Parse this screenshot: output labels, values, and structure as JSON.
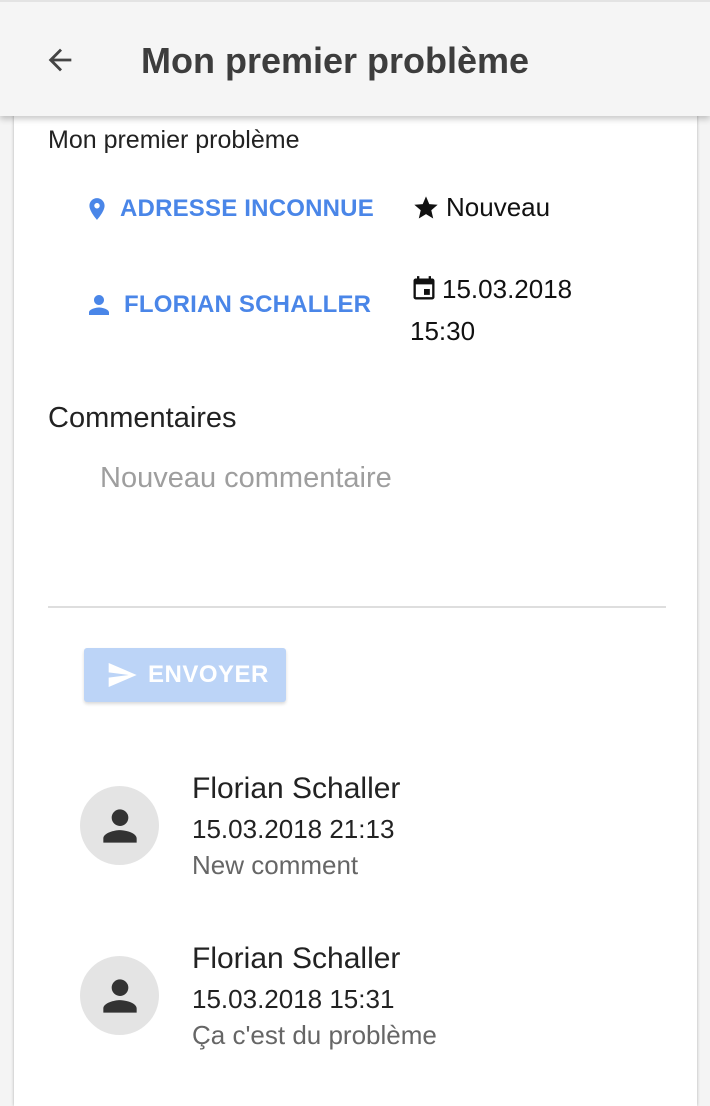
{
  "header": {
    "title": "Mon premier problème",
    "back_icon": "arrow-back-icon"
  },
  "problem": {
    "title": "Mon premier problème",
    "address": "ADRESSE INCONNUE",
    "address_icon": "location-pin-icon",
    "status": "Nouveau",
    "status_icon": "star-icon",
    "reporter": "FLORIAN SCHALLER",
    "reporter_icon": "person-icon",
    "date_icon": "calendar-icon",
    "date": "15.03.2018",
    "time": "15:30"
  },
  "comments_section": {
    "title": "Commentaires",
    "input_placeholder": "Nouveau commentaire",
    "input_value": "",
    "send_label": "ENVOYER",
    "send_icon": "send-icon"
  },
  "comments": [
    {
      "author": "Florian Schaller",
      "datetime": "15.03.2018 21:13",
      "text": "New comment",
      "avatar_icon": "person-avatar-icon"
    },
    {
      "author": "Florian Schaller",
      "datetime": "15.03.2018 15:31",
      "text": "Ça c'est du problème",
      "avatar_icon": "person-avatar-icon"
    }
  ],
  "colors": {
    "accent": "#4a86e8",
    "send_button_disabled": "#bcd4f7",
    "toolbar_bg": "#f5f5f5"
  }
}
